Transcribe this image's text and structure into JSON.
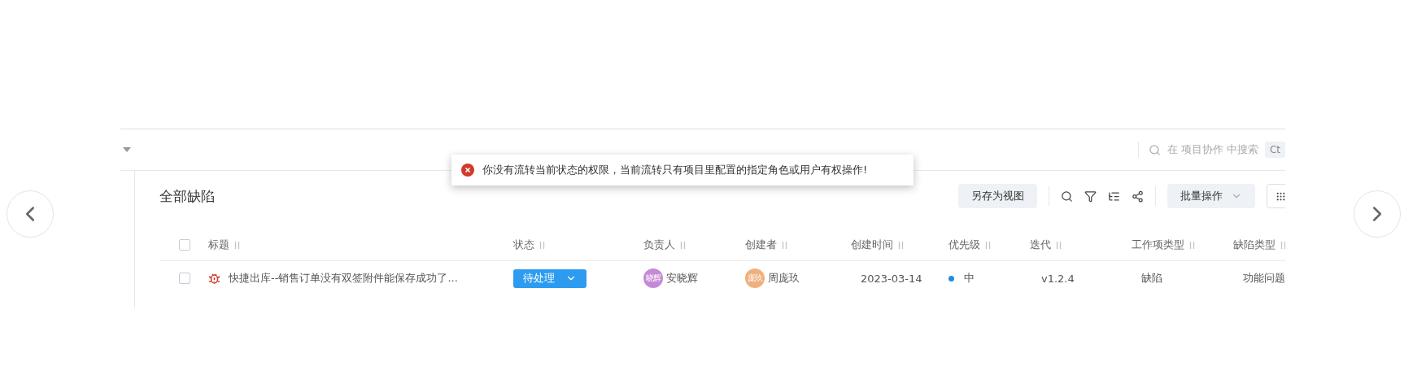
{
  "search": {
    "placeholder": "在 项目协作 中搜索",
    "shortcut": "Ct"
  },
  "toast": {
    "kind": "error",
    "message": "你没有流转当前状态的权限，当前流转只有项目里配置的指定角色或用户有权操作!"
  },
  "view": {
    "title": "全部缺陷",
    "save_button": "另存为视图",
    "batch_button": "批量操作"
  },
  "table": {
    "all_checked": false,
    "columns": [
      "标题",
      "状态",
      "负责人",
      "创建者",
      "创建时间",
      "优先级",
      "迭代",
      "工作项类型",
      "缺陷类型"
    ],
    "rows": [
      {
        "checked": false,
        "title": "快捷出库--销售订单没有双签附件能保存成功了...",
        "status": "待处理",
        "assignee": {
          "avatar": "晓辉",
          "name": "安晓辉",
          "color": "#c58ad6"
        },
        "creator": {
          "avatar": "庞玖",
          "name": "周庞玖",
          "color": "#f0b07e"
        },
        "created": "2023-03-14",
        "priority": {
          "label": "中",
          "color": "#1f8ce6"
        },
        "iteration": "v1.2.4",
        "type": "缺陷",
        "defect_type": "功能问题"
      }
    ]
  }
}
